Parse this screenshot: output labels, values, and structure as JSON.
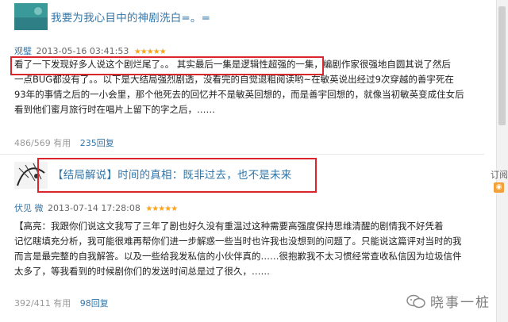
{
  "review1": {
    "title": "我要为我心目中的神剧洗白=。=",
    "author": "观璧",
    "datetime": "2013-05-16 03:41:53",
    "stars": "★★★★★",
    "line1_highlight": "看了一下发现好多人说这个剧烂尾了。。",
    "line1_rest_a": "其实最后一集是逻辑性超强的一集，",
    "line1_rest_b": "编剧作家很强地自圆其说了然后",
    "line2": "一点BUG都没有了。。以下是大结局强烈剧透，没看完的自觉退粗阅读哟~在敏英说出经过9次穿越的善宇死在",
    "line3": "93年的事情之后的一小会里，那个他死去的回忆并不是敏英回想的，而是善宇回想的，就像当初敏英变成住女后",
    "line4": "看到他们蜜月旅行时在唱片上留下的字之后，……",
    "useful": "486/569 有用",
    "replies": "235回复"
  },
  "review2": {
    "title": "【结局解说】时间的真相：既非过去，也不是未来",
    "author": "伏见 微",
    "datetime": "2013-07-14 17:28:08",
    "stars": "★★★★★",
    "line1": "【高亮：我跟你们说这文我写了三年了剧也好久没有重温过这种需要高强度保持思维清醒的剧情我不好凭着",
    "line2": "记忆瞎填充分析，我可能很难再帮你们进一步解惑一些当时也许我也没想到的问题了。只能说这篇评对当时的我",
    "line3": "而言是最完整的自我解答。以及一些给我发私信的小伙伴真的……很抱歉我不太习惯经常查收私信因为垃圾信件",
    "line4": "太多了，等我看到的时候剧你们的发送时间总是过了很久，……",
    "useful": "392/411 有用",
    "replies": "98回复"
  },
  "sidebar": {
    "subscribe": "订阅"
  },
  "watermark": {
    "text": "晓事一桩"
  },
  "colors": {
    "highlight_box": "#d8262c",
    "link": "#3377aa",
    "stars": "#f6a623"
  }
}
